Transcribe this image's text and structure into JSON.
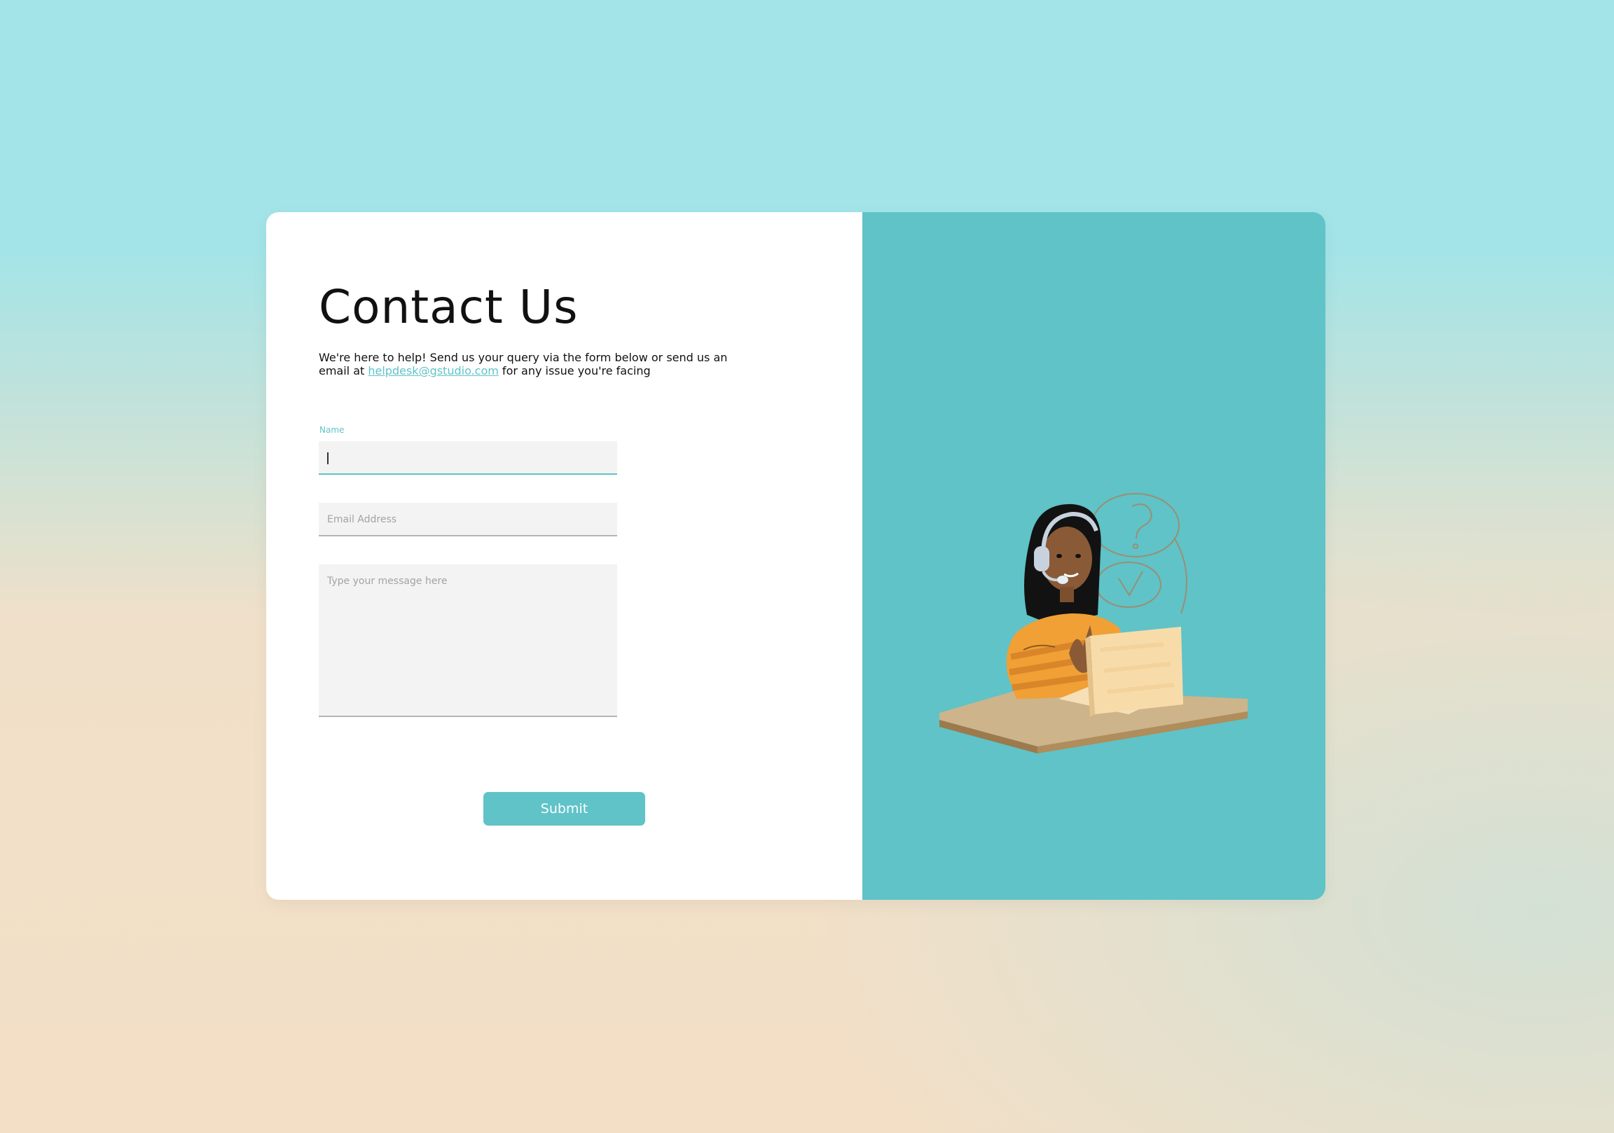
{
  "page": {
    "title": "Contact Us",
    "intro_before": "We're here to help! Send us your query via the form below or send us an email at ",
    "email_link": "helpdesk@gstudio.com",
    "intro_after": " for any issue you're facing"
  },
  "form": {
    "name_label": "Name",
    "name_value": "",
    "email_placeholder": "Email Address",
    "message_placeholder": "Type your message here",
    "submit_label": "Submit"
  },
  "illustration": {
    "icon": "support-agent-illustration",
    "bubble_1": "?",
    "bubble_2": "✓"
  },
  "colors": {
    "accent": "#5fc3c8",
    "background_top": "#a3e4e8",
    "background_bottom": "#f3dfc6"
  }
}
